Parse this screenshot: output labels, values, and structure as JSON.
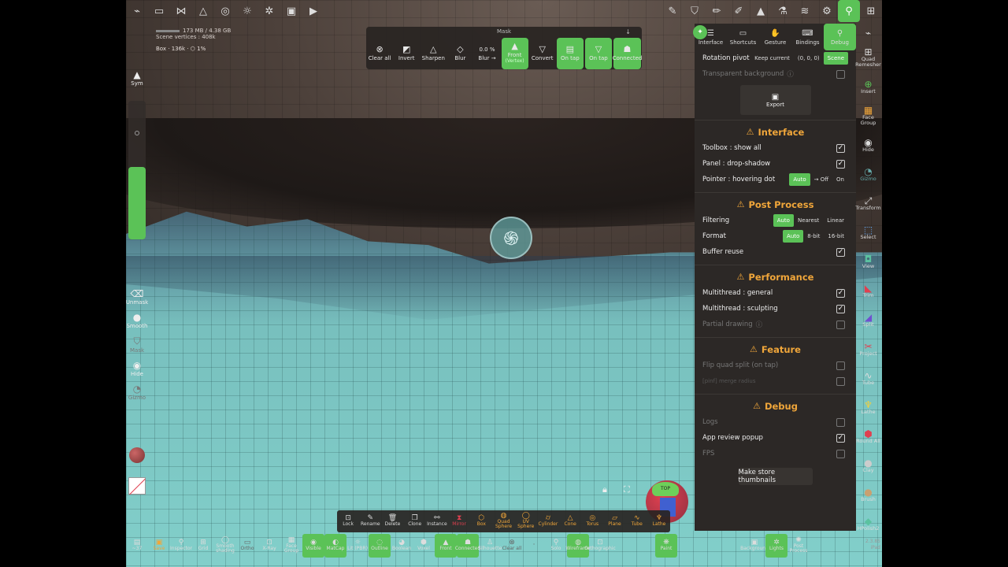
{
  "stats": {
    "memory": "173 MB / 4.38 GB",
    "vertices": "Scene vertices : 408k"
  },
  "object": {
    "label": "Box · 136k · ⬡ 1%"
  },
  "mask": {
    "title": "Mask",
    "tools": [
      {
        "label": "Clear all",
        "icon": "⊗"
      },
      {
        "label": "Invert",
        "icon": "◩"
      },
      {
        "label": "Sharpen",
        "icon": "△"
      },
      {
        "label": "Blur",
        "icon": "◇"
      },
      {
        "label": "Blur →",
        "icon": "0.0 %"
      },
      {
        "label": "Front",
        "sub": "(Vertex)",
        "icon": "▲"
      },
      {
        "label": "Convert",
        "icon": "▽"
      },
      {
        "label": "On tap",
        "icon": "▤"
      },
      {
        "label": "On tap",
        "icon": "▽"
      },
      {
        "label": "Connected",
        "icon": "☗"
      }
    ]
  },
  "left_tools": {
    "sym": "Sym",
    "unmask": "Unmask",
    "smooth": "Smooth",
    "mask": "Mask",
    "hide": "Hide",
    "gizmo": "Gizmo"
  },
  "slider": {
    "value": 0.52
  },
  "settings": {
    "tabs": [
      "Interface",
      "Shortcuts",
      "Gesture",
      "Bindings",
      "Debug"
    ],
    "rotation_pivot": "Rotation pivot",
    "keep_current": "Keep current",
    "pivot_value": "(0, 0, 0)",
    "scene": "Scene",
    "transparent_bg": "Transparent background",
    "export": "Export",
    "sections": {
      "interface": "Interface",
      "post_process": "Post Process",
      "performance": "Performance",
      "feature": "Feature",
      "debug": "Debug"
    },
    "toolbox": "Toolbox : show all",
    "panel": "Panel : drop-shadow",
    "pointer": "Pointer : hovering dot",
    "pointer_opts": [
      "Auto",
      "→ Off",
      "On"
    ],
    "filtering": "Filtering",
    "filtering_opts": [
      "Auto",
      "Nearest",
      "Linear"
    ],
    "format": "Format",
    "format_opts": [
      "Auto",
      "8-bit",
      "16-bit"
    ],
    "buffer_reuse": "Buffer reuse",
    "mt_general": "Multithread : general",
    "mt_sculpt": "Multithread : sculpting",
    "partial": "Partial drawing",
    "flip_quad": "Flip quad split (on tap)",
    "quad_merge": "[pinf] merge radius",
    "logs": "Logs",
    "app_review": "App review popup",
    "fps": "FPS",
    "thumbs": "Make store thumbnails"
  },
  "right_tools": [
    "Quad Remesher",
    "Insert",
    "Face Group",
    "Hide",
    "Gizmo",
    "Transform",
    "Select",
    "View",
    "Trim",
    "Split",
    "Project",
    "Tube",
    "Lathe",
    "Round All",
    "Clay",
    "Brush",
    "HPolish2"
  ],
  "primitives": [
    "Lock",
    "Rename",
    "Delete",
    "Clone",
    "Instance",
    "Mirror",
    "Box",
    "Quad Sphere",
    "UV Sphere",
    "Cylinder",
    "Cone",
    "Torus",
    "Plane",
    "Tube",
    "Lathe"
  ],
  "bottom": [
    "~37",
    "Save",
    "Inspector",
    "Grid",
    "Smooth shading",
    "Ortho",
    "X-Ray",
    "Face Group",
    "Visible",
    "MatCap",
    "Lit (PBR)",
    "Outline",
    "Boolean",
    "Voxel",
    "Front",
    "Connected",
    "Silhouette",
    "Clear all",
    "Solo",
    "Wireframe",
    "Orthographic",
    "Paint",
    "Background",
    "Lights",
    "Post Process"
  ],
  "gizmo": {
    "top": "TOP"
  },
  "version": {
    "line1": "2.3.85",
    "line2": "iPad"
  },
  "colors": {
    "accent": "#5bc257",
    "warning": "#f0a63a",
    "panel": "#2c2826"
  }
}
